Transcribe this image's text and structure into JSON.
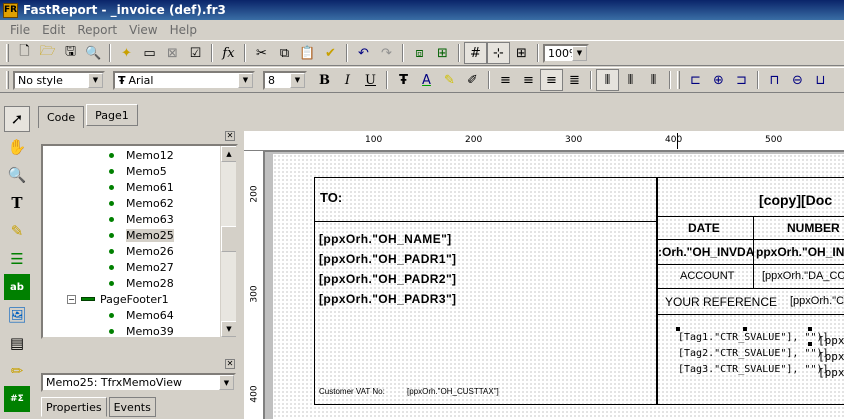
{
  "window": {
    "title": "FastReport - _invoice (def).fr3",
    "app_icon_text": "FR"
  },
  "menu": [
    "File",
    "Edit",
    "Report",
    "View",
    "Help"
  ],
  "toolbar": {
    "zoom": "100%",
    "style": "No style",
    "font": "Arial",
    "size": "8"
  },
  "tabs": {
    "code": "Code",
    "page1": "Page1"
  },
  "tree": {
    "items": [
      {
        "label": "Memo12",
        "kind": "memo",
        "selected": false
      },
      {
        "label": "Memo5",
        "kind": "memo",
        "selected": false
      },
      {
        "label": "Memo61",
        "kind": "memo",
        "selected": false
      },
      {
        "label": "Memo62",
        "kind": "memo",
        "selected": false
      },
      {
        "label": "Memo63",
        "kind": "memo",
        "selected": false
      },
      {
        "label": "Memo25",
        "kind": "memo",
        "selected": true
      },
      {
        "label": "Memo26",
        "kind": "memo",
        "selected": false
      },
      {
        "label": "Memo27",
        "kind": "memo",
        "selected": false
      },
      {
        "label": "Memo28",
        "kind": "memo",
        "selected": false
      },
      {
        "label": "PageFooter1",
        "kind": "band",
        "selected": false
      },
      {
        "label": "Memo64",
        "kind": "memo",
        "selected": false
      },
      {
        "label": "Memo39",
        "kind": "memo",
        "selected": false
      }
    ],
    "band_expander": "−"
  },
  "inspector": {
    "object": "Memo25: TfrxMemoView",
    "tab_properties": "Properties",
    "tab_events": "Events"
  },
  "ruler": {
    "h_labels": [
      "100",
      "200",
      "300",
      "400",
      "500"
    ],
    "v_labels": [
      "200",
      "300",
      "400"
    ]
  },
  "report": {
    "to_label": "TO:",
    "name_fields": [
      "[ppxOrh.\"OH_NAME\"]",
      "[ppxOrh.\"OH_PADR1\"]",
      "[ppxOrh.\"OH_PADR2\"]",
      "[ppxOrh.\"OH_PADR3\"]"
    ],
    "vat_label": "Customer VAT No:",
    "vat_value": "[ppxOrh.\"OH_CUSTTAX\"]",
    "doc_title": "[copy][Doc",
    "date_header": "DATE",
    "number_header": "NUMBER",
    "date_value": ":Orh.\"OH_INVDA",
    "number_value": "ppxOrh.\"OH_INV",
    "account_label": "ACCOUNT",
    "account_value": "[ppxOrh.\"DA_CO",
    "ref_label": "YOUR REFERENCE",
    "ref_value": "[ppxOrh.\"C",
    "tag_fields": [
      "[Tag1.\"CTR_SVALUE\"], \"\")]",
      "[Tag2.\"CTR_SVALUE\"], \"\")]",
      "[Tag3.\"CTR_SVALUE\"], \"\")]"
    ],
    "tag_right": [
      "[ppx",
      "[ppx",
      "[ppx"
    ]
  },
  "colors": {
    "titlebar": "#0a246a",
    "face": "#d4d0c8",
    "tree_dot": "#008000"
  }
}
